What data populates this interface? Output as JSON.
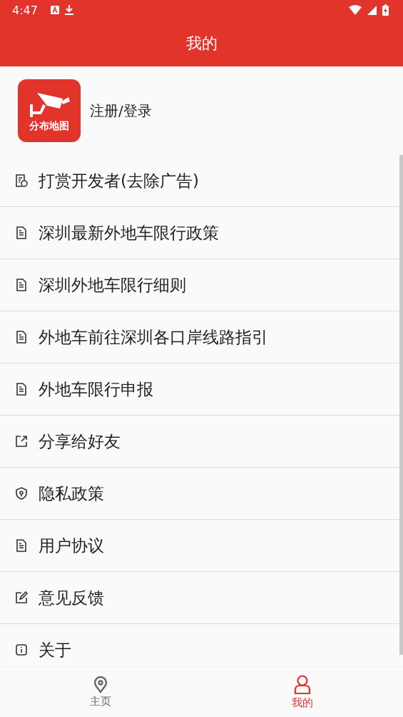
{
  "status_bar": {
    "time": "4:47"
  },
  "title": "我的",
  "profile": {
    "logo_text": "分布地图",
    "login": "注册/登录"
  },
  "menu": [
    {
      "kind": "reward",
      "label": "打赏开发者(去除广告)"
    },
    {
      "kind": "doc",
      "label": "深圳最新外地车限行政策"
    },
    {
      "kind": "doc",
      "label": "深圳外地车限行细则"
    },
    {
      "kind": "doc",
      "label": "外地车前往深圳各口岸线路指引"
    },
    {
      "kind": "doc",
      "label": "外地车限行申报"
    },
    {
      "kind": "share",
      "label": "分享给好友"
    },
    {
      "kind": "shield",
      "label": "隐私政策"
    },
    {
      "kind": "doc",
      "label": "用户协议"
    },
    {
      "kind": "edit",
      "label": "意见反馈"
    },
    {
      "kind": "info",
      "label": "关于"
    }
  ],
  "bottom_nav": [
    {
      "kind": "home",
      "label": "主页",
      "selected": false
    },
    {
      "kind": "me",
      "label": "我的",
      "selected": true
    }
  ]
}
